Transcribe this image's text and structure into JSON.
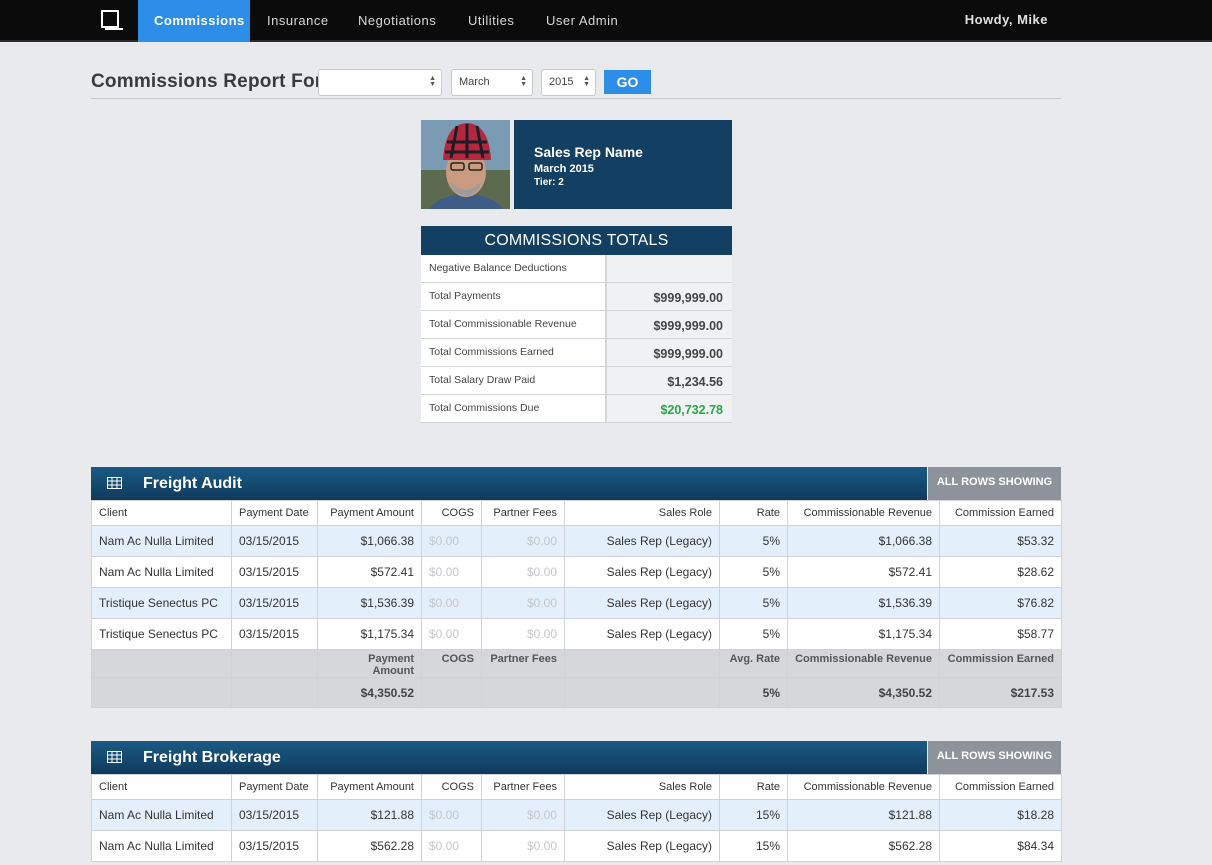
{
  "nav": {
    "items": [
      {
        "label": "Commissions",
        "active": true
      },
      {
        "label": "Insurance",
        "active": false
      },
      {
        "label": "Negotiations",
        "active": false
      },
      {
        "label": "Utilities",
        "active": false
      },
      {
        "label": "User Admin",
        "active": false
      }
    ],
    "greeting": "Howdy, Mike"
  },
  "report": {
    "title": "Commissions Report For",
    "rep_select": "",
    "month_select": "March",
    "year_select": "2015",
    "go_label": "GO"
  },
  "profile": {
    "name": "Sales Rep Name",
    "period": "March 2015",
    "tier": "Tier: 2"
  },
  "totals": {
    "heading": "COMMISSIONS TOTALS",
    "rows": [
      {
        "label": "Negative Balance Deductions",
        "value": ""
      },
      {
        "label": "Total Payments",
        "value": "$999,999.00"
      },
      {
        "label": "Total Commissionable Revenue",
        "value": "$999,999.00"
      },
      {
        "label": "Total Commissions Earned",
        "value": "$999,999.00"
      },
      {
        "label": "Total Salary Draw Paid",
        "value": "$1,234.56"
      },
      {
        "label": "Total Commissions Due",
        "value": "$20,732.78"
      }
    ],
    "due_color": "#28a745"
  },
  "accent_color": "#2d8ee8",
  "sections": [
    {
      "title": "Freight Audit",
      "badge": "ALL ROWS SHOWING",
      "headers": [
        "Client",
        "Payment Date",
        "Payment Amount",
        "COGS",
        "Partner Fees",
        "Sales Role",
        "Rate",
        "Commissionable Revenue",
        "Commission Earned"
      ],
      "rows": [
        [
          "Nam Ac Nulla Limited",
          "03/15/2015",
          "$1,066.38",
          "$0.00",
          "$0.00",
          "Sales Rep (Legacy)",
          "5%",
          "$1,066.38",
          "$53.32"
        ],
        [
          "Nam Ac Nulla Limited",
          "03/15/2015",
          "$572.41",
          "$0.00",
          "$0.00",
          "Sales Rep (Legacy)",
          "5%",
          "$572.41",
          "$28.62"
        ],
        [
          "Tristique Senectus PC",
          "03/15/2015",
          "$1,536.39",
          "$0.00",
          "$0.00",
          "Sales Rep (Legacy)",
          "5%",
          "$1,536.39",
          "$76.82"
        ],
        [
          "Tristique Senectus PC",
          "03/15/2015",
          "$1,175.34",
          "$0.00",
          "$0.00",
          "Sales Rep (Legacy)",
          "5%",
          "$1,175.34",
          "$58.77"
        ]
      ],
      "summary_labels": [
        "",
        "",
        "Payment Amount",
        "COGS",
        "Partner Fees",
        "",
        "Avg. Rate",
        "Commissionable Revenue",
        "Commission Earned"
      ],
      "summary_values": [
        "",
        "",
        "$4,350.52",
        "",
        "",
        "",
        "5%",
        "$4,350.52",
        "$217.53"
      ]
    },
    {
      "title": "Freight Brokerage",
      "badge": "ALL ROWS SHOWING",
      "headers": [
        "Client",
        "Payment Date",
        "Payment Amount",
        "COGS",
        "Partner Fees",
        "Sales Role",
        "Rate",
        "Commissionable Revenue",
        "Commission Earned"
      ],
      "rows": [
        [
          "Nam Ac Nulla Limited",
          "03/15/2015",
          "$121.88",
          "$0.00",
          "$0.00",
          "Sales Rep (Legacy)",
          "15%",
          "$121.88",
          "$18.28"
        ],
        [
          "Nam Ac Nulla Limited",
          "03/15/2015",
          "$562.28",
          "$0.00",
          "$0.00",
          "Sales Rep (Legacy)",
          "15%",
          "$562.28",
          "$84.34"
        ]
      ]
    }
  ]
}
